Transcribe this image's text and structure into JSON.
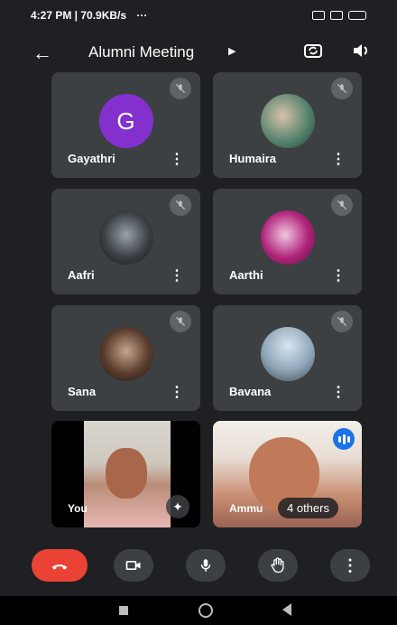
{
  "status_bar": {
    "time_and_speed": "4:27 PM | 70.9KB/s",
    "extra": "···"
  },
  "header": {
    "title": "Alumni Meeting"
  },
  "participants": [
    {
      "name": "Gayathri",
      "avatar_letter": "G",
      "muted": true
    },
    {
      "name": "Humaira",
      "muted": true
    },
    {
      "name": "Aafri",
      "muted": true
    },
    {
      "name": "Aarthi",
      "muted": true
    },
    {
      "name": "Sana",
      "muted": true
    },
    {
      "name": "Bavana",
      "muted": true
    }
  ],
  "video_tiles": {
    "self_label": "You",
    "speaker_label": "Ammu",
    "others_label": "4 others"
  },
  "colors": {
    "end_call": "#ea4335",
    "avatar_purple": "#8430ce",
    "speaking_badge": "#1a73e8",
    "tile_bg": "#3c4043"
  }
}
